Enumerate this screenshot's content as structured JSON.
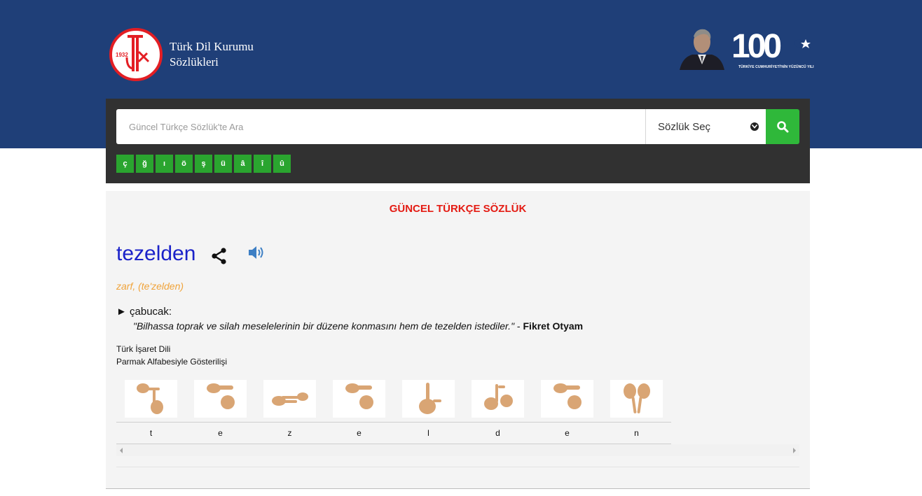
{
  "header": {
    "brand_line1": "Türk Dil Kurumu",
    "brand_line2": "Sözlükleri",
    "logo_year": "1932",
    "logo_letters": "TDK",
    "centennial_number": "100",
    "centennial_sub": "TÜRKİYE CUMHURİYETİ'NİN YÜZÜNCÜ YILI",
    "band_color": "#1f3f78"
  },
  "search": {
    "placeholder": "Güncel Türkçe Sözlük'te Ara",
    "value": "",
    "dict_select": "Sözlük Seç",
    "button_icon": "search-icon",
    "letters": [
      "ç",
      "ğ",
      "ı",
      "ö",
      "ş",
      "ü",
      "â",
      "î",
      "û"
    ],
    "letter_color": "#2aa52f"
  },
  "result": {
    "dictionary": "GÜNCEL TÜRKÇE SÖZLÜK",
    "word": "tezelden",
    "share_icon": "share-icon",
    "audio_icon": "speaker-icon",
    "pos": "zarf, (te'zelden)",
    "meaning_marker": "►",
    "meaning": "çabucak:",
    "example_quote": "\"Bilhassa toprak ve silah meselelerinin bir düzene konmasını hem de tezelden istediler.\"",
    "example_sep": " - ",
    "example_author": "Fikret Otyam",
    "sign_title": "Türk İşaret Dili",
    "sign_subtitle": "Parmak Alfabesiyle Gösterilişi",
    "sign_letters": [
      "t",
      "e",
      "z",
      "e",
      "l",
      "d",
      "e",
      "n"
    ],
    "word_color": "#1b22c9",
    "title_color": "#e41b13",
    "pos_color": "#f0a33a"
  }
}
